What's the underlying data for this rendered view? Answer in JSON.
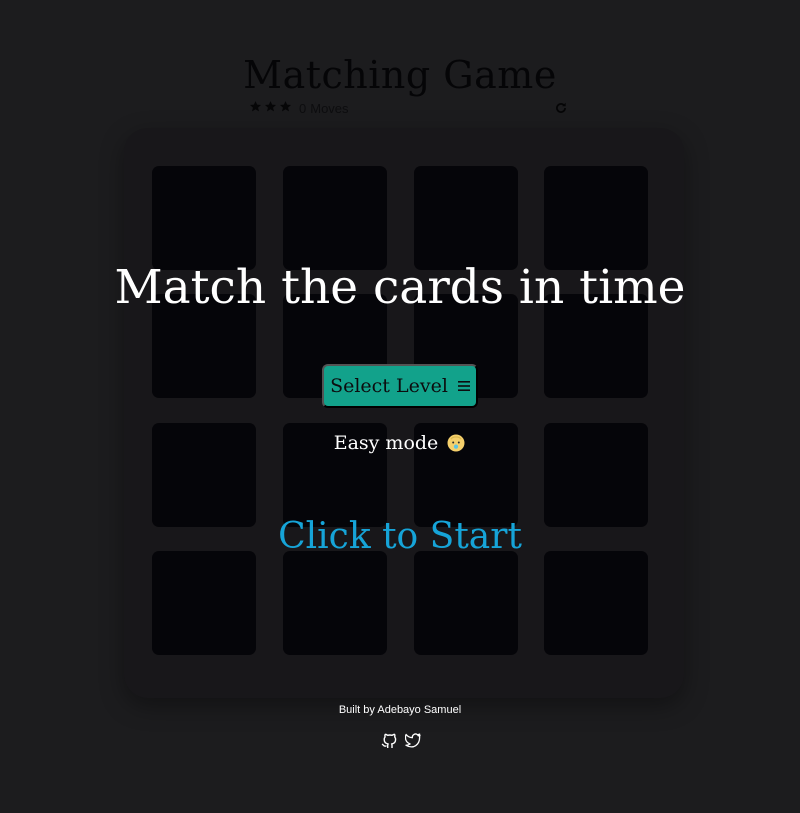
{
  "game": {
    "title": "Matching Game",
    "moves_count": "0",
    "moves_label": "Moves",
    "stars": 3,
    "star_icon": "star-icon",
    "restart_icon": "restart-icon"
  },
  "overlay": {
    "heading": "Match the cards in time",
    "level_button_label": "Select Level",
    "level_button_icon": "menu-icon",
    "mode_text": "Easy mode",
    "mode_icon": "baby-face-icon",
    "start_label": "Click to Start"
  },
  "footer": {
    "credit": "Built by Adebayo Samuel",
    "links": [
      "github-icon",
      "twitter-icon"
    ]
  },
  "deck": {
    "rows": 4,
    "cols": 4
  },
  "colors": {
    "background": "#1c1c1e",
    "deck": "#18171a",
    "card_back": "#050509",
    "button": "#12a28b",
    "start_text": "#16a4d8",
    "overlay_text": "#ffffff"
  }
}
